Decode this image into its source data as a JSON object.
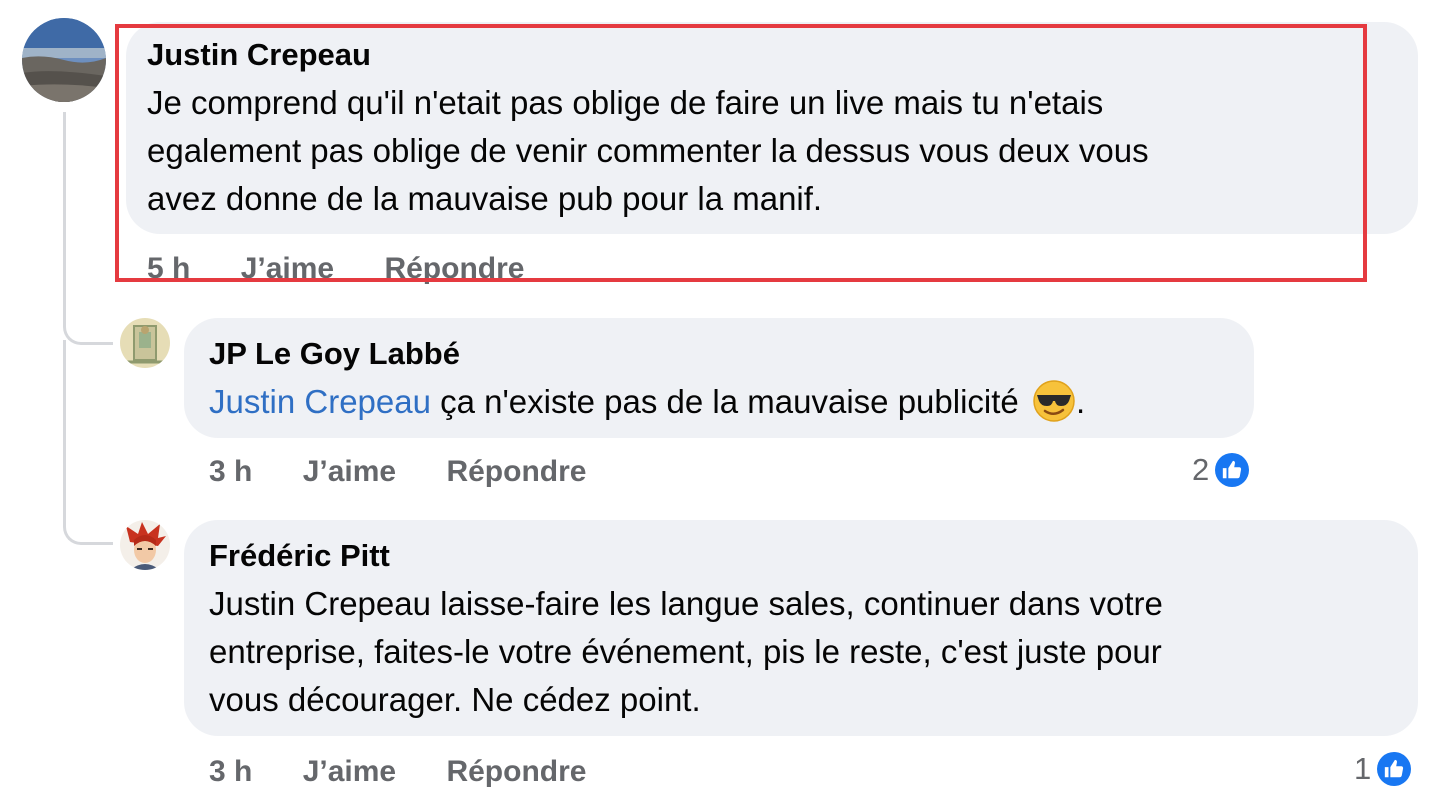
{
  "comments": [
    {
      "author": "Justin Crepeau",
      "lines": [
        "Je comprend qu'il n'etait pas oblige de faire un live mais tu n'etais",
        "egalement pas oblige de venir commenter la dessus vous deux vous",
        "avez donne de la mauvaise pub pour la manif."
      ],
      "time": "5 h",
      "like_label": "J’aime",
      "reply_label": "Répondre"
    },
    {
      "author": "JP Le Goy Labbé",
      "mention": "Justin Crepeau",
      "text": " ça n'existe pas de la mauvaise publicité ",
      "emoji": "smiling-face-with-sunglasses",
      "text_end": ".",
      "time": "3 h",
      "like_label": "J’aime",
      "reply_label": "Répondre",
      "reaction_count": "2"
    },
    {
      "author": "Frédéric Pitt",
      "lines": [
        "Justin Crepeau laisse-faire les langue sales, continuer dans votre",
        "entreprise, faites-le votre événement, pis le reste, c'est juste pour",
        "vous décourager. Ne cédez point."
      ],
      "time": "3 h",
      "like_label": "J’aime",
      "reply_label": "Répondre",
      "reaction_count": "1"
    }
  ],
  "colors": {
    "bubble": "#eff1f5",
    "meta_text": "#65676b",
    "mention": "#2f6fc4",
    "like_badge": "#1877f2",
    "highlight_frame": "#e53a40"
  },
  "icons": {
    "like": "thumbs-up-icon",
    "emoji": "smiling-face-with-sunglasses-icon"
  }
}
